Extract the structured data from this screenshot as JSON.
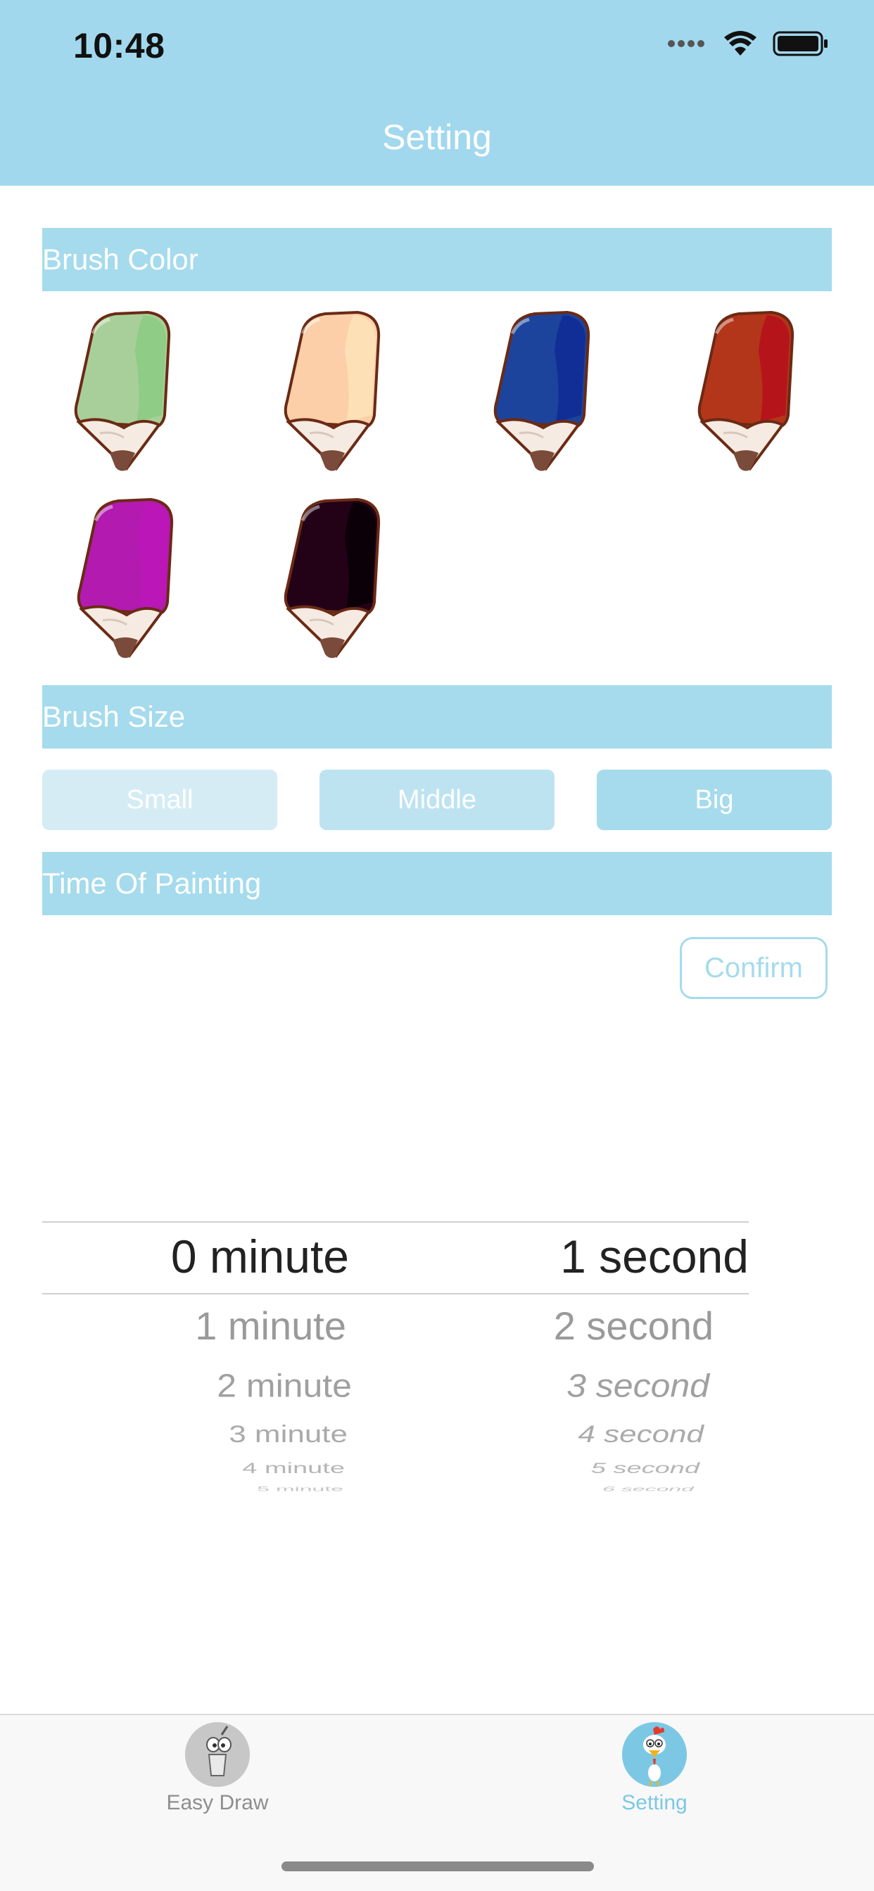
{
  "status_bar": {
    "time": "10:48"
  },
  "nav": {
    "title": "Setting"
  },
  "brush_color": {
    "label": "Brush Color",
    "colors": [
      {
        "name": "green",
        "body": "#a8cf99",
        "stripe": "#8fcc85"
      },
      {
        "name": "peach",
        "body": "#fccfa9",
        "stripe": "#fde0b5"
      },
      {
        "name": "blue",
        "body": "#1d449c",
        "stripe": "#112e96"
      },
      {
        "name": "red",
        "body": "#b3361a",
        "stripe": "#b6141b"
      },
      {
        "name": "magenta",
        "body": "#b31ab0",
        "stripe": "#bb17b8"
      },
      {
        "name": "black",
        "body": "#230218",
        "stripe": "#0b0008"
      }
    ]
  },
  "brush_size": {
    "label": "Brush Size",
    "options": [
      {
        "label": "Small",
        "color": "#d5ecf5"
      },
      {
        "label": "Middle",
        "color": "#bde3f1"
      },
      {
        "label": "Big",
        "color": "#a5dbec"
      }
    ]
  },
  "time_of_painting": {
    "label": "Time Of Painting",
    "confirm_label": "Confirm",
    "minutes": [
      "0 minute",
      "1 minute",
      "2 minute",
      "3 minute",
      "4 minute",
      "5 minute"
    ],
    "seconds": [
      "1 second",
      "2 second",
      "3 second",
      "4 second",
      "5 second",
      "6 second"
    ]
  },
  "tabbar": {
    "tabs": [
      {
        "label": "Easy Draw",
        "active": false
      },
      {
        "label": "Setting",
        "active": true
      }
    ],
    "active_color": "#7cc8e4",
    "inactive_color": "#8e8e8e"
  }
}
